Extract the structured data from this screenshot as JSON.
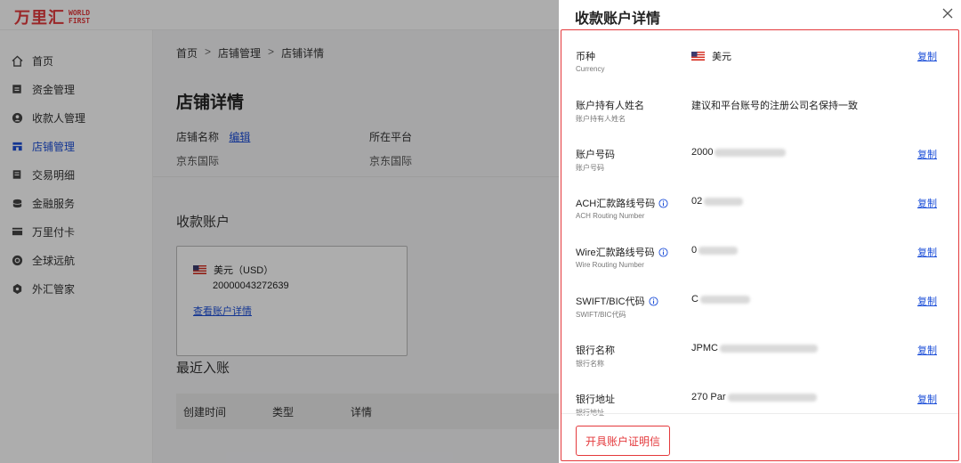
{
  "app": {
    "logo_cn": "万里汇",
    "logo_en_1": "WORLD",
    "logo_en_2": "FIRST"
  },
  "sidebar": {
    "items": [
      {
        "label": "首页",
        "icon": "home-icon",
        "active": false
      },
      {
        "label": "资金管理",
        "icon": "wallet-icon",
        "active": false
      },
      {
        "label": "收款人管理",
        "icon": "user-icon",
        "active": false
      },
      {
        "label": "店铺管理",
        "icon": "store-icon",
        "active": true
      },
      {
        "label": "交易明细",
        "icon": "receipt-icon",
        "active": false
      },
      {
        "label": "金融服务",
        "icon": "coins-icon",
        "active": false
      },
      {
        "label": "万里付卡",
        "icon": "card-icon",
        "active": false
      },
      {
        "label": "全球远航",
        "icon": "globe-icon",
        "active": false
      },
      {
        "label": "外汇管家",
        "icon": "exchange-icon",
        "active": false
      }
    ]
  },
  "breadcrumb": {
    "items": [
      "首页",
      "店铺管理",
      "店铺详情"
    ],
    "separator": ">"
  },
  "main": {
    "title": "店铺详情",
    "store_name_label": "店铺名称",
    "edit_label": "编辑",
    "store_name_value": "京东国际",
    "platform_label": "所在平台",
    "platform_value": "京东国际",
    "accounts_title": "收款账户",
    "account_card": {
      "currency": "美元（USD）",
      "number": "20000043272639",
      "link": "查看账户详情"
    },
    "recent_title": "最近入账",
    "table_headers": [
      "创建时间",
      "类型",
      "详情"
    ]
  },
  "drawer": {
    "title": "收款账户详情",
    "rows": [
      {
        "label": "币种",
        "sub": "Currency",
        "value": "美元",
        "flag": true,
        "copy": "复制",
        "info": false
      },
      {
        "label": "账户持有人姓名",
        "sub": "账户持有人姓名",
        "value": "建议和平台账号的注册公司名保持一致",
        "copy": "",
        "info": false
      },
      {
        "label": "账户号码",
        "sub": "账户号码",
        "value": "2000",
        "blur": 80,
        "copy": "复制",
        "info": false
      },
      {
        "label": "ACH汇款路线号码",
        "sub": "ACH Routing Number",
        "value": "02",
        "blur": 44,
        "copy": "复制",
        "info": true
      },
      {
        "label": "Wire汇款路线号码",
        "sub": "Wire Routing Number",
        "value": "0",
        "blur": 44,
        "copy": "复制",
        "info": true
      },
      {
        "label": "SWIFT/BIC代码",
        "sub": "SWIFT/BIC代码",
        "value": "C",
        "blur": 56,
        "copy": "复制",
        "info": true
      },
      {
        "label": "银行名称",
        "sub": "银行名称",
        "value": "JPMC",
        "blur": 110,
        "copy": "复制",
        "info": false
      },
      {
        "label": "银行地址",
        "sub": "银行地址",
        "value": "270 Par",
        "blur": 100,
        "copy": "复制",
        "info": false
      }
    ],
    "cert_button": "开具账户证明信"
  },
  "colors": {
    "brand_red": "#e4393c",
    "link_blue": "#1d4fd8"
  }
}
